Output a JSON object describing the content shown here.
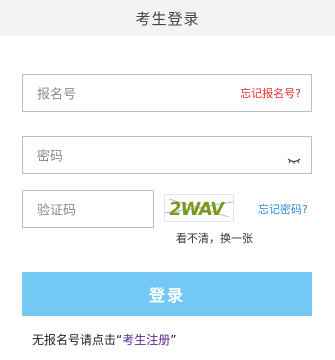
{
  "header": {
    "title": "考生登录"
  },
  "username": {
    "placeholder": "报名号",
    "forgot_label": "忘记报名号?"
  },
  "password": {
    "placeholder": "密码"
  },
  "captcha": {
    "placeholder": "验证码",
    "image_text": "2WAV",
    "refresh_label": "看不清，换一张",
    "forgot_password_label": "忘记密码?"
  },
  "login_button": {
    "label": "登录"
  },
  "footer": {
    "prefix": "无报名号请点击",
    "open_quote": "“",
    "register_label": "考生注册",
    "close_quote": "”"
  },
  "colors": {
    "accent_button": "#74c8f4",
    "forgot_num": "#e0312b",
    "forgot_pwd": "#2d8bd6",
    "register_link": "#5a2a8a"
  }
}
